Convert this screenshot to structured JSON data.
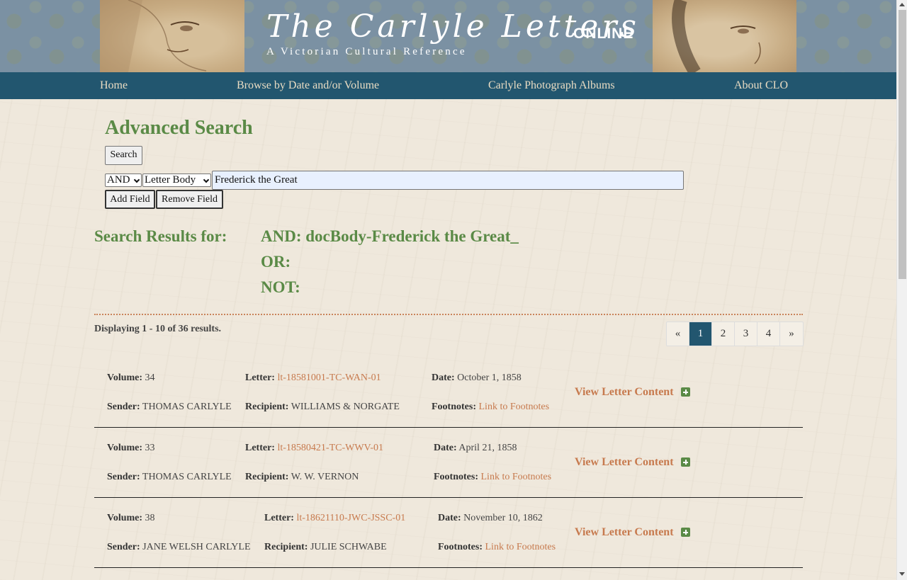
{
  "header": {
    "title": "The Carlyle Letters",
    "title_suffix": "ONLINE",
    "subtitle": "A Victorian Cultural Reference"
  },
  "nav": {
    "items": [
      {
        "label": "Home"
      },
      {
        "label": "Browse by Date and/or Volume"
      },
      {
        "label": "Carlyle Photograph Albums"
      },
      {
        "label": "About CLO"
      }
    ]
  },
  "search": {
    "heading": "Advanced Search",
    "search_button": "Search",
    "operator_select": "AND",
    "field_select": "Letter Body",
    "query_value": "Frederick the Great",
    "add_field_button": "Add Field",
    "remove_field_button": "Remove Field"
  },
  "results": {
    "label": "Search Results for:",
    "and_line": "AND: docBody-Frederick the Great_",
    "or_line": "OR:",
    "not_line": "NOT:",
    "displaying": "Displaying 1 - 10 of 36 results.",
    "pagination": [
      "«",
      "1",
      "2",
      "3",
      "4",
      "»"
    ],
    "active_page": "1",
    "labels": {
      "volume": "Volume:",
      "letter": "Letter:",
      "date": "Date:",
      "sender": "Sender:",
      "recipient": "Recipient:",
      "footnotes": "Footnotes:",
      "view_content": "View Letter Content"
    },
    "items": [
      {
        "volume": "34",
        "letter": "lt-18581001-TC-WAN-01",
        "date": "October 1, 1858",
        "sender": "THOMAS CARLYLE",
        "recipient": "WILLIAMS & NORGATE",
        "footnotes": "Link to Footnotes"
      },
      {
        "volume": "33",
        "letter": "lt-18580421-TC-WWV-01",
        "date": "April 21, 1858",
        "sender": "THOMAS CARLYLE",
        "recipient": "W. W. VERNON",
        "footnotes": "Link to Footnotes"
      },
      {
        "volume": "38",
        "letter": "lt-18621110-JWC-JSSC-01",
        "date": "November 10, 1862",
        "sender": "JANE WELSH CARLYLE",
        "recipient": "JULIE SCHWABE",
        "footnotes": "Link to Footnotes"
      }
    ]
  },
  "colors": {
    "nav_bg": "#22566f",
    "heading_green": "#5a8a46",
    "link_orange": "#c77a4e"
  }
}
